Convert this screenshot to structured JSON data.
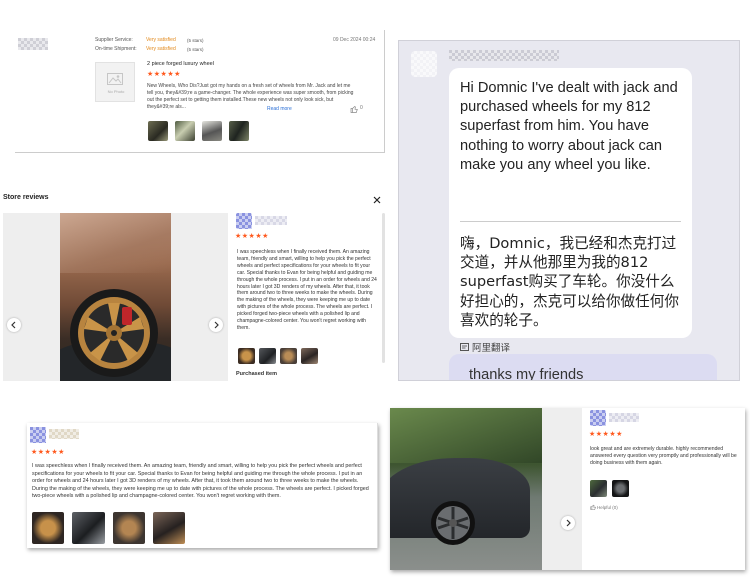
{
  "panel1": {
    "supplier_service_label": "Supplier Service:",
    "supplier_service_value": "Very satisfied",
    "supplier_service_stars": "(5 stars)",
    "ontime_label": "On-time Shipment:",
    "ontime_value": "Very satisfied",
    "ontime_stars": "(5 stars)",
    "date": "09 Dec 2024 00:24",
    "no_photo_label": "No Photo",
    "product_title": "2 piece forged luxury wheel",
    "stars": "★★★★★",
    "review_text": "New Wheels, Who Dis?Just got my hands on a fresh set of wheels from Mr. Jack and let me tell you, they&#39;re a game-changer. The whole experience was super smooth, from picking out the perfect set to getting them installed.These new wheels not only look sick, but they&#39;re als...",
    "read_more": "Read more",
    "like_count": "0"
  },
  "panel2": {
    "english_text": "Hi Domnic I've dealt with jack and purchased wheels for my 812 superfast from him. You have  nothing to worry about jack can make you any wheel you like.",
    "chinese_text": "嗨，Domnic，我已经和杰克打过交道，并从他那里为我的812 superfast购买了车轮。你没什么好担心的，杰克可以给你做任何你喜欢的轮子。",
    "translate_label": "阿里翻译",
    "next_message": "thanks my friends"
  },
  "panel3": {
    "title": "Store reviews",
    "stars": "★★★★★",
    "review_text": "I was speechless when I finally received them. An amazing team, friendly and smart, willing to help you pick the perfect wheels and perfect specifications for your wheels to fit your car. Special thanks to Evan for being helpful and guiding me through the whole process. I put in an order for wheels and 24 hours later I got 3D renders of my wheels. After that, it took them around two to three weeks to make the wheels. During the making of the wheels, they were keeping me up to date with pictures of the whole process. The wheels are perfect. I picked forged two-piece wheels with a polished lip and champagne-colored center. You won't regret working with them.",
    "purchased_label": "Purchased item"
  },
  "panel4": {
    "stars": "★★★★★",
    "review_text": "I was speechless when I finally received them. An amazing team, friendly and smart, willing to help you pick the perfect wheels and perfect specifications for your wheels to fit your car. Special thanks to Evan for being helpful and guiding me through the whole process. I put in an order for wheels and 24 hours later I got 3D renders of my wheels. After that, it took them around two to three weeks to make the wheels. During the making of the wheels, they were keeping me up to date with pictures of the whole process. The wheels are perfect. I picked forged two-piece wheels with a polished lip and champagne-colored center. You won't regret working with them."
  },
  "panel5": {
    "stars": "★★★★★",
    "review_text": "look great and are extremely durable. highly recommended answered every question very promptly and professionally will be doing business with them again.",
    "helpful_label": "Helpful (0)"
  },
  "colors": {
    "star": "#ff5a1f",
    "satisfied": "#e2891b",
    "link": "#2a6fd6",
    "chat_bg": "#e8e8f0"
  }
}
